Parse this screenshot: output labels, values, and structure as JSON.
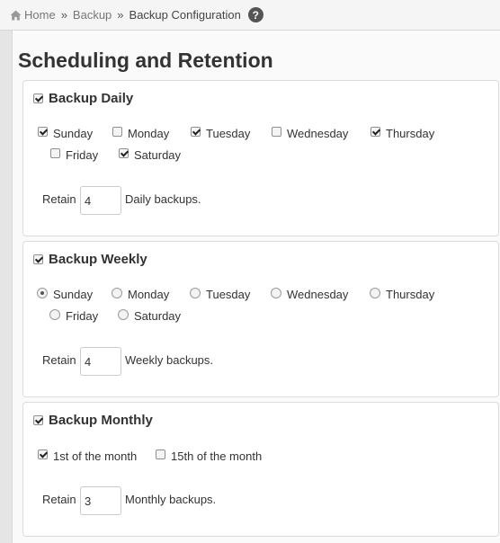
{
  "breadcrumb": {
    "home": "Home",
    "separator": "»",
    "section": "Backup",
    "current": "Backup Configuration",
    "help": "?"
  },
  "page_title": "Scheduling and Retention",
  "daily": {
    "heading": "Backup Daily",
    "enabled": true,
    "days": [
      {
        "label": "Sunday",
        "checked": true
      },
      {
        "label": "Monday",
        "checked": false
      },
      {
        "label": "Tuesday",
        "checked": true
      },
      {
        "label": "Wednesday",
        "checked": false
      },
      {
        "label": "Thursday",
        "checked": true
      },
      {
        "label": "Friday",
        "checked": false
      },
      {
        "label": "Saturday",
        "checked": true
      }
    ],
    "retain_label": "Retain",
    "retain_value": "4",
    "retain_suffix": "Daily backups."
  },
  "weekly": {
    "heading": "Backup Weekly",
    "enabled": true,
    "selected_day": "Sunday",
    "days": [
      "Sunday",
      "Monday",
      "Tuesday",
      "Wednesday",
      "Thursday",
      "Friday",
      "Saturday"
    ],
    "retain_label": "Retain",
    "retain_value": "4",
    "retain_suffix": "Weekly backups."
  },
  "monthly": {
    "heading": "Backup Monthly",
    "enabled": true,
    "options": [
      {
        "label": "1st of the month",
        "checked": true
      },
      {
        "label": "15th of the month",
        "checked": false
      }
    ],
    "retain_label": "Retain",
    "retain_value": "3",
    "retain_suffix": "Monthly backups."
  }
}
